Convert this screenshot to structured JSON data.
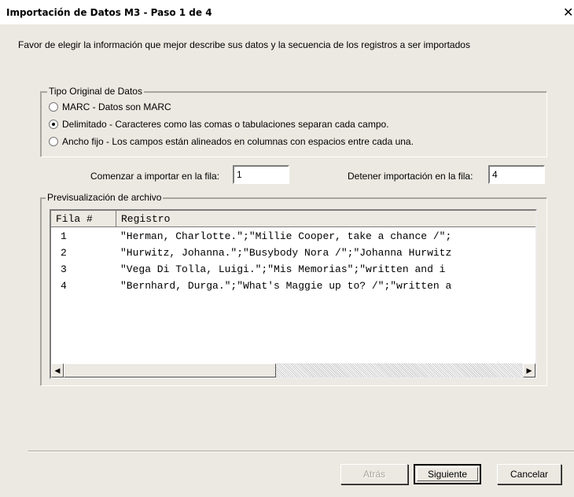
{
  "window": {
    "title": "Importación de Datos M3 - Paso 1 de 4",
    "close_glyph": "✕"
  },
  "instructions": "Favor de elegir la información que mejor describe sus datos y la secuencia de los registros a ser importados",
  "data_type": {
    "legend": "Tipo Original de Datos",
    "options": [
      {
        "label": "MARC - Datos son MARC",
        "selected": false
      },
      {
        "label": "Delimitado - Caracteres como las comas o tabulaciones separan cada campo.",
        "selected": true
      },
      {
        "label": "Ancho fijo - Los campos están alineados en columnas con espacios entre cada una.",
        "selected": false
      }
    ]
  },
  "rows_range": {
    "start_label": "Comenzar a importar en la fila:",
    "start_value": "1",
    "stop_label": "Detener importación en la fila:",
    "stop_value": "4"
  },
  "preview": {
    "legend": "Previsualización de archivo",
    "columns": [
      "Fila #",
      "Registro"
    ],
    "rows": [
      {
        "num": "1",
        "record": "\"Herman, Charlotte.\";\"Millie Cooper, take a chance /\";"
      },
      {
        "num": "2",
        "record": "\"Hurwitz, Johanna.\";\"Busybody Nora /\";\"Johanna Hurwitz"
      },
      {
        "num": "3",
        "record": "\"Vega Di Tolla, Luigi.\";\"Mis Memorias\";\"written and i"
      },
      {
        "num": "4",
        "record": "\"Bernhard, Durga.\";\"What's Maggie up to? /\";\"written a"
      }
    ],
    "scroll_left_glyph": "◀",
    "scroll_right_glyph": "▶"
  },
  "buttons": {
    "back": "Atrás",
    "next": "Siguiente",
    "cancel": "Cancelar"
  },
  "icons": {
    "close": "close-icon",
    "scroll_left": "arrow-left-icon",
    "scroll_right": "arrow-right-icon"
  }
}
